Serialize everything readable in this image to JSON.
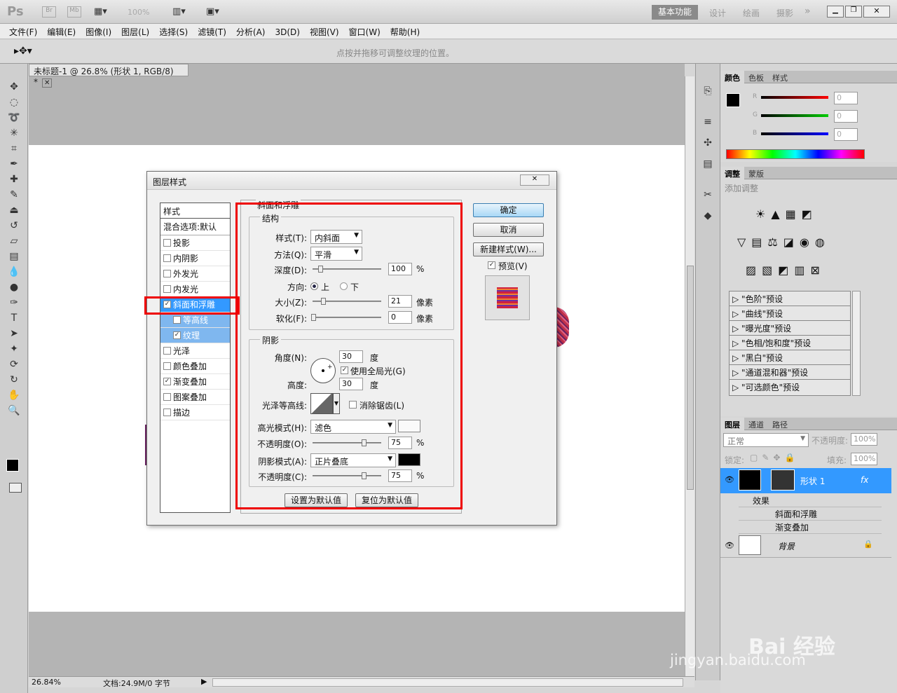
{
  "app": {
    "logo": "Ps",
    "br": "Br",
    "mb": "Mb",
    "zoom": "100%",
    "workspace": "基本功能",
    "ws_design": "设计",
    "ws_paint": "绘画",
    "ws_photo": "摄影",
    "ws_more": "»"
  },
  "menu": [
    "文件(F)",
    "编辑(E)",
    "图像(I)",
    "图层(L)",
    "选择(S)",
    "滤镜(T)",
    "分析(A)",
    "3D(D)",
    "视图(V)",
    "窗口(W)",
    "帮助(H)"
  ],
  "options_hint": "点按并拖移可调整纹理的位置。",
  "doc": {
    "tab": "未标题-1 @ 26.8% (形状 1, RGB/8) *",
    "status_zoom": "26.84%",
    "status_doc": "文档:24.9M/0 字节"
  },
  "dialog": {
    "title": "图层样式",
    "styles_header": "样式",
    "blend": "混合选项:默认",
    "items": [
      {
        "label": "投影",
        "checked": false
      },
      {
        "label": "内阴影",
        "checked": false
      },
      {
        "label": "外发光",
        "checked": false
      },
      {
        "label": "内发光",
        "checked": false
      },
      {
        "label": "斜面和浮雕",
        "checked": true
      },
      {
        "label": "等高线",
        "checked": false
      },
      {
        "label": "纹理",
        "checked": true
      },
      {
        "label": "光泽",
        "checked": false
      },
      {
        "label": "颜色叠加",
        "checked": false
      },
      {
        "label": "渐变叠加",
        "checked": true
      },
      {
        "label": "图案叠加",
        "checked": false
      },
      {
        "label": "描边",
        "checked": false
      }
    ],
    "section_title": "斜面和浮雕",
    "structure": {
      "title": "结构",
      "style_label": "样式(T):",
      "style_value": "内斜面",
      "method_label": "方法(Q):",
      "method_value": "平滑",
      "depth_label": "深度(D):",
      "depth_value": "100",
      "depth_unit": "%",
      "dir_label": "方向:",
      "dir_up": "上",
      "dir_down": "下",
      "size_label": "大小(Z):",
      "size_value": "21",
      "size_unit": "像素",
      "soften_label": "软化(F):",
      "soften_value": "0",
      "soften_unit": "像素"
    },
    "shading": {
      "title": "阴影",
      "angle_label": "角度(N):",
      "angle_value": "30",
      "angle_unit": "度",
      "global_light": "使用全局光(G)",
      "altitude_label": "高度:",
      "altitude_value": "30",
      "altitude_unit": "度",
      "gloss_label": "光泽等高线:",
      "antialias": "消除锯齿(L)",
      "highlight_label": "高光模式(H):",
      "highlight_value": "滤色",
      "hop_label": "不透明度(O):",
      "hop_value": "75",
      "hop_unit": "%",
      "shadow_label": "阴影模式(A):",
      "shadow_value": "正片叠底",
      "sop_label": "不透明度(C):",
      "sop_value": "75",
      "sop_unit": "%"
    },
    "set_default": "设置为默认值",
    "reset_default": "复位为默认值",
    "ok": "确定",
    "cancel": "取消",
    "new_style": "新建样式(W)...",
    "preview": "预览(V)"
  },
  "panels": {
    "color_tabs": [
      "颜色",
      "色板",
      "样式"
    ],
    "r": "R",
    "g": "G",
    "b": "B",
    "rv": "0",
    "gv": "0",
    "bv": "0",
    "adj_tabs": [
      "调整",
      "蒙版"
    ],
    "adj_title": "添加调整",
    "presets": [
      "\"色阶\"预设",
      "\"曲线\"预设",
      "\"曝光度\"预设",
      "\"色相/饱和度\"预设",
      "\"黑白\"预设",
      "\"通道混和器\"预设",
      "\"可选颜色\"预设"
    ],
    "layer_tabs": [
      "图层",
      "通道",
      "路径"
    ],
    "blend_mode": "正常",
    "opacity_label": "不透明度:",
    "opacity": "100%",
    "lock_label": "锁定:",
    "fill_label": "填充:",
    "fill": "100%",
    "layer1": "形状 1",
    "fx": "fx",
    "effects": "效果",
    "eff1": "斜面和浮雕",
    "eff2": "渐变叠加",
    "bg": "背景"
  },
  "watermark": {
    "brand": "Bai 经验",
    "url": "jingyan.baidu.com"
  }
}
